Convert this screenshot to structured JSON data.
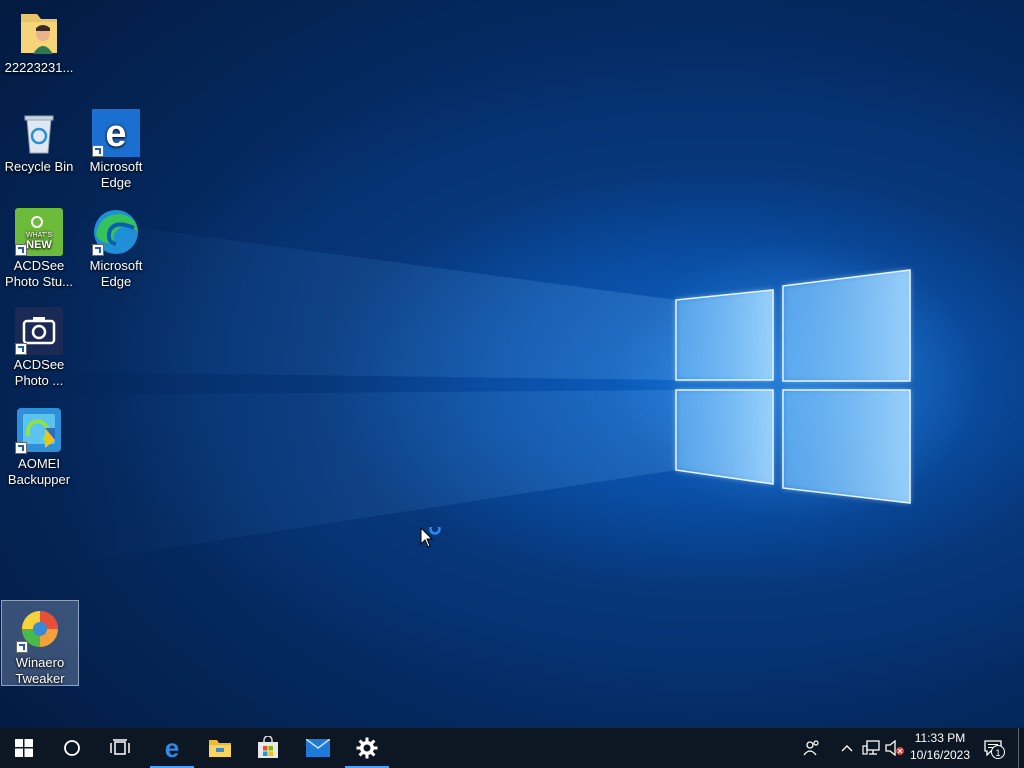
{
  "desktop": {
    "icons": [
      {
        "label": "22223231...",
        "icon": "user-folder-icon"
      },
      {
        "label": "Recycle Bin",
        "icon": "recycle-bin-icon"
      },
      {
        "label": "Microsoft Edge",
        "icon": "edge-legacy-icon"
      },
      {
        "label": "ACDSee Photo Stu...",
        "icon": "acdsee-whats-new-icon",
        "badge": "WHAT'S NEW"
      },
      {
        "label": "Microsoft Edge",
        "icon": "edge-chromium-icon"
      },
      {
        "label": "ACDSee Photo ...",
        "icon": "acdsee-camera-icon"
      },
      {
        "label": "AOMEI Backupper",
        "icon": "aomei-backupper-icon"
      },
      {
        "label": "Winaero Tweaker",
        "icon": "winaero-tweaker-icon",
        "selected": true
      }
    ]
  },
  "taskbar": {
    "buttons": [
      {
        "name": "start",
        "icon": "windows-logo-icon"
      },
      {
        "name": "search",
        "icon": "cortana-circle-icon"
      },
      {
        "name": "task-view",
        "icon": "task-view-icon"
      },
      {
        "name": "edge",
        "icon": "edge-legacy-icon",
        "active": true
      },
      {
        "name": "file-explorer",
        "icon": "folder-icon"
      },
      {
        "name": "store",
        "icon": "store-bag-icon"
      },
      {
        "name": "mail",
        "icon": "mail-envelope-icon"
      },
      {
        "name": "settings",
        "icon": "gear-icon",
        "active": true
      }
    ],
    "tray": {
      "people_icon": "people-icon",
      "chevron_icon": "chevron-up-icon",
      "network_icon": "network-icon",
      "volume_icon": "volume-muted-icon",
      "time": "11:33 PM",
      "date": "10/16/2023",
      "notification_count": "1"
    }
  },
  "colors": {
    "taskbar_bg": "#0d1724",
    "active_indicator": "#4aa3ff",
    "wallpaper_blue": "#0a4fa6"
  }
}
